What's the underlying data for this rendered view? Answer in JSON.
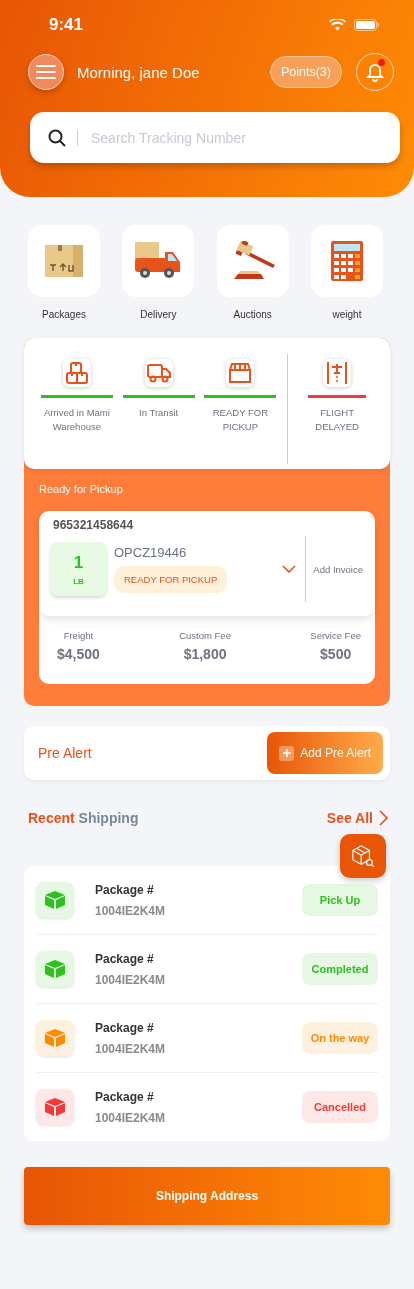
{
  "status_bar": {
    "time": "9:41"
  },
  "header": {
    "greeting": "Morning, jane Doe",
    "points": "Points(3)",
    "has_notification": true
  },
  "search": {
    "placeholder": "Search Tracking Number"
  },
  "shortcuts": [
    {
      "kind": "box",
      "label": "Packages"
    },
    {
      "kind": "truck",
      "label": "Delivery"
    },
    {
      "kind": "gavel",
      "label": "Auctions"
    },
    {
      "kind": "calculator",
      "label": "weight"
    }
  ],
  "tracking_steps": [
    {
      "kind": "boxes",
      "label": "Arrived in Mami Warehouse",
      "color": "#2ec01e"
    },
    {
      "kind": "truck",
      "label": "In Transit",
      "color": "#2ec01e"
    },
    {
      "kind": "store",
      "label": "READY FOR PICKUP",
      "color": "#2ec01e"
    },
    {
      "kind": "plane",
      "label": "FLIGHT DELAYED",
      "color": "#f23a3a"
    }
  ],
  "pickup": {
    "title": "Ready for Pickup",
    "tracking_number": "965321458644",
    "weight": "1",
    "unit": "LB",
    "code": "OPCZ19446",
    "status": "READY FOR PICKUP",
    "action": "Add Invoice",
    "fees": [
      {
        "label": "Freight",
        "value": "$4,500"
      },
      {
        "label": "Custom Fee",
        "value": "$1,800"
      },
      {
        "label": "Service Fee",
        "value": "$500"
      }
    ]
  },
  "pre_alert": {
    "title": "Pre Alert",
    "button": "Add Pre Alert"
  },
  "recent": {
    "title_first": "Recent",
    "title_second": "Shipping",
    "see_all": "See All",
    "items": [
      {
        "label": "Package #",
        "number": "1004IE2K4M",
        "status": "Pick Up",
        "color": "#2ec01e"
      },
      {
        "label": "Package #",
        "number": "1004IE2K4M",
        "status": "Completed",
        "color": "#2ec01e"
      },
      {
        "label": "Package #",
        "number": "1004IE2K4M",
        "status": "On the way",
        "color": "#ff8a00"
      },
      {
        "label": "Package #",
        "number": "1004IE2K4M",
        "status": "Cancelled",
        "color": "#f23a3a"
      }
    ]
  },
  "footer_button": "Shipping Address"
}
